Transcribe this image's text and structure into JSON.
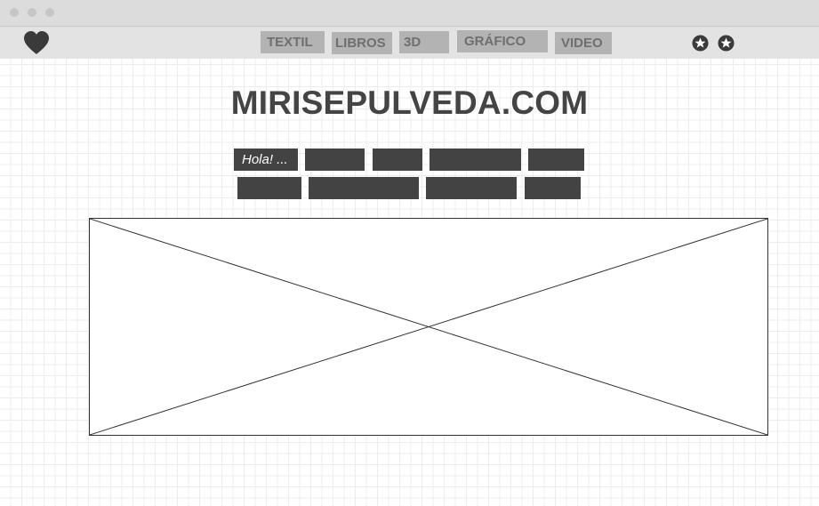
{
  "window": {
    "controls": [
      "close",
      "minimize",
      "maximize"
    ]
  },
  "nav": {
    "logo_icon": "heart-icon",
    "items": [
      {
        "label": "TEXTIL"
      },
      {
        "label": "LIBROS"
      },
      {
        "label": "3D"
      },
      {
        "label": "GRÁFICO"
      },
      {
        "label": "VIDEO"
      }
    ],
    "right_icons": [
      "star-icon",
      "star-icon"
    ]
  },
  "main": {
    "site_title": "MIRISEPULVEDA.COM",
    "tags": [
      {
        "label": "Hola! ..."
      },
      {
        "label": ""
      },
      {
        "label": ""
      },
      {
        "label": ""
      },
      {
        "label": ""
      },
      {
        "label": ""
      },
      {
        "label": ""
      },
      {
        "label": ""
      },
      {
        "label": ""
      }
    ],
    "image_placeholder": "image-placeholder"
  },
  "colors": {
    "nav_bg": "#e3e3e3",
    "nav_item_bg": "#b3b3b3",
    "nav_item_text": "#6f6f6f",
    "title_text": "#444444",
    "tag_bg": "#434343"
  }
}
